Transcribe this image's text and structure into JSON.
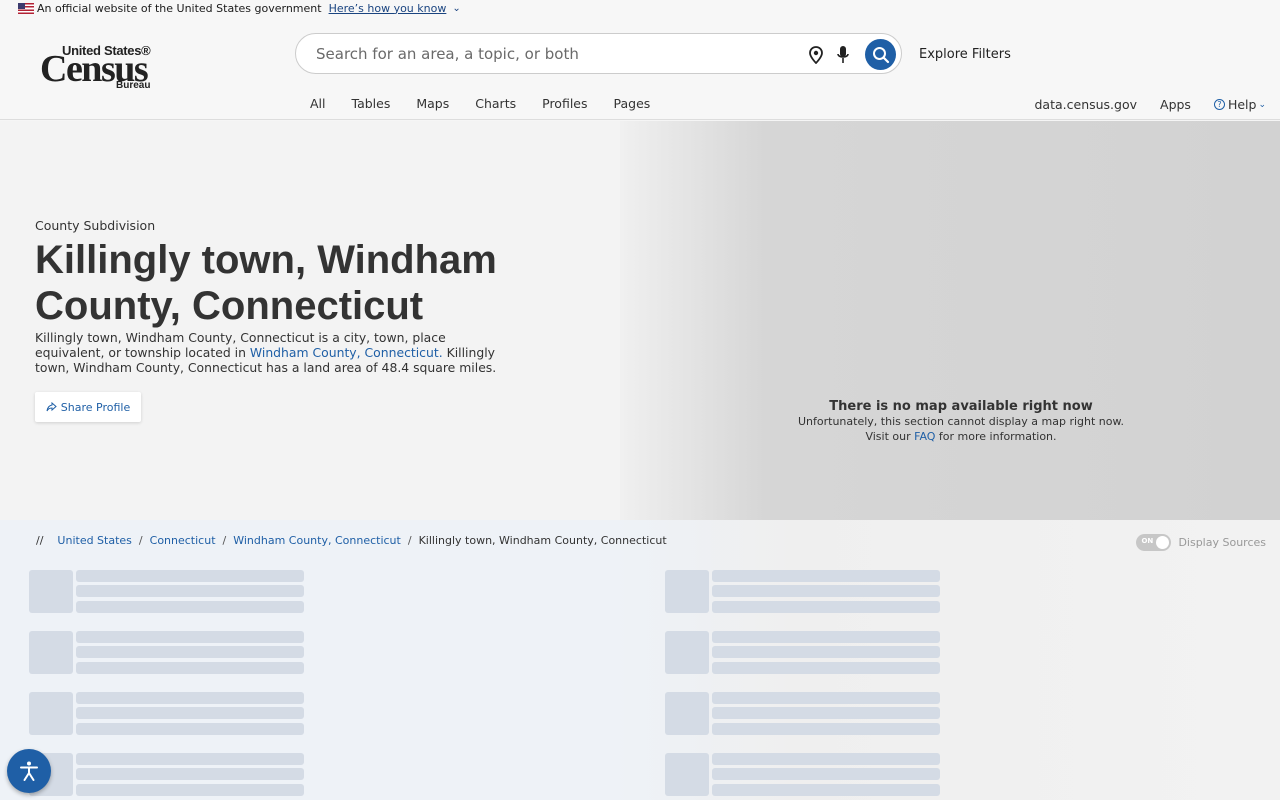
{
  "gov_banner": {
    "text": "An official website of the United States government",
    "link": "Here’s how you know"
  },
  "logo": {
    "line1": "United States®",
    "line2": "Census",
    "line3": "Bureau"
  },
  "search": {
    "placeholder": "Search for an area, a topic, or both"
  },
  "explore_filters": "Explore Filters",
  "tabs": [
    "All",
    "Tables",
    "Maps",
    "Charts",
    "Profiles",
    "Pages"
  ],
  "right_nav": {
    "data_link": "data.census.gov",
    "apps": "Apps",
    "help": "Help"
  },
  "hero": {
    "geo_type": "County Subdivision",
    "title": "Killingly town, Windham County, Connecticut",
    "desc_before": "Killingly town, Windham County, Connecticut is a city, town, place equivalent, or township located in ",
    "desc_link": "Windham County, Connecticut.",
    "desc_after": " Killingly town, Windham County, Connecticut has a land area of 48.4 square miles.",
    "share": "Share Profile"
  },
  "map": {
    "heading": "There is no map available right now",
    "line1": "Unfortunately, this section cannot display a map right now.",
    "line2_before": "Visit our ",
    "line2_link": "FAQ",
    "line2_after": " for more information."
  },
  "breadcrumb": {
    "prefix": "//",
    "items": [
      "United States",
      "Connecticut",
      "Windham County, Connecticut"
    ],
    "current": "Killingly town, Windham County, Connecticut"
  },
  "sources_toggle": {
    "state": "ON",
    "label": "Display Sources"
  },
  "colors": {
    "accent": "#1f5fa6",
    "skeleton": "#d4dbe5"
  }
}
